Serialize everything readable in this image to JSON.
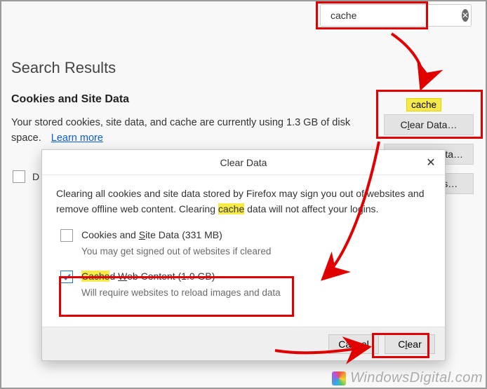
{
  "search": {
    "value": "cache"
  },
  "results_heading": "Search Results",
  "section": {
    "title": "Cookies and Site Data",
    "desc_part1": "Your stored cookies, site data, and cache are currently using ",
    "desc_size": "1.3 GB",
    "desc_part2": " of disk space.",
    "learn_more": "Learn more"
  },
  "side_tooltip": "cache",
  "side_buttons": {
    "clear_pre": "C",
    "clear_u": "l",
    "clear_post": "ear Data…",
    "manage_pre": "",
    "manage_u": "M",
    "manage_post": "anage Data…",
    "exc_pre": "E",
    "exc_u": "x",
    "exc_post": "ceptions…"
  },
  "bg_checkbox_label_part": "D",
  "modal": {
    "title": "Clear Data",
    "para_pre": "Clearing all cookies and site data stored by Firefox may sign you out of websites and remove offline web content. Clearing ",
    "para_hl": "cache",
    "para_post": " data will not affect your logins.",
    "opt1": {
      "checked": false,
      "label_pre": "Cookies and ",
      "label_u": "S",
      "label_post": "ite Data (331 MB)",
      "sub": "You may get signed out of websites if cleared"
    },
    "opt2": {
      "checked": true,
      "hl": "Cache",
      "label_pre": "d ",
      "label_u": "W",
      "label_post": "eb Content (1.0 GB)",
      "sub": "Will require websites to reload images and data"
    },
    "cancel": "Cancel",
    "clear_pre": "C",
    "clear_u": "l",
    "clear_post": "ear"
  },
  "watermark": "WindowsDigital.com"
}
